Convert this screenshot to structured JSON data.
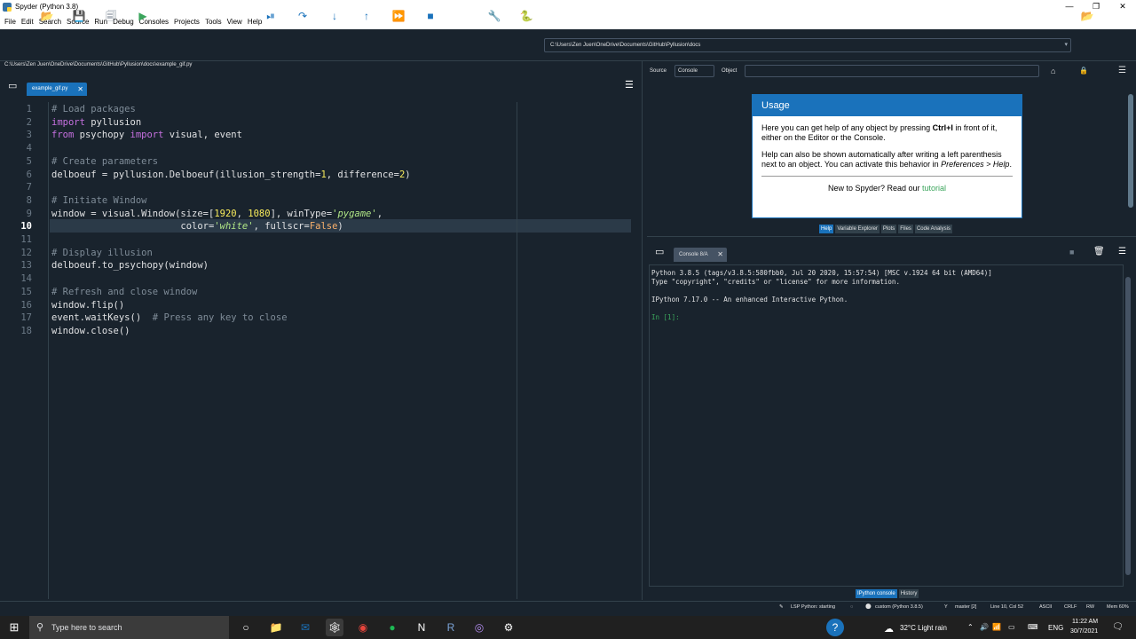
{
  "window": {
    "title": "Spyder (Python 3.8)"
  },
  "menu": [
    "File",
    "Edit",
    "Search",
    "Source",
    "Run",
    "Debug",
    "Consoles",
    "Projects",
    "Tools",
    "View",
    "Help"
  ],
  "toolbar": {
    "path": "C:\\Users\\Zen Juen\\OneDrive\\Documents\\GitHub\\Pyllusion\\docs"
  },
  "editor": {
    "file_path": "C:\\Users\\Zen Juen\\OneDrive\\Documents\\GitHub\\Pyllusion\\docs\\example_gif.py",
    "tab": "example_gif.py",
    "current_line": 10,
    "line_numbers": [
      "1",
      "2",
      "3",
      "4",
      "5",
      "6",
      "7",
      "8",
      "9",
      "10",
      "11",
      "12",
      "13",
      "14",
      "15",
      "16",
      "17",
      "18"
    ],
    "lines": [
      "# Load packages",
      "import pyllusion",
      "from psychopy import visual, event",
      "",
      "# Create parameters",
      "delboeuf = pyllusion.Delboeuf(illusion_strength=1, difference=2)",
      "",
      "# Initiate Window",
      "window = visual.Window(size=[1920, 1080], winType='pygame',",
      "                       color='white', fullscr=False)",
      "",
      "# Display illusion",
      "delboeuf.to_psychopy(window)",
      "",
      "# Refresh and close window",
      "window.flip()",
      "event.waitKeys()  # Press any key to close",
      "window.close()"
    ]
  },
  "help": {
    "source_label": "Source",
    "source_value": "Console",
    "object_label": "Object",
    "usage_title": "Usage",
    "p1a": "Here you can get help of any object by pressing ",
    "p1b": "Ctrl+I",
    "p1c": " in front of it, either on the Editor or the Console.",
    "p2a": "Help can also be shown automatically after writing a left parenthesis next to an object. You can activate this behavior in ",
    "p2b": "Preferences > Help",
    "p2c": ".",
    "tutorial_text": "New to Spyder? Read our ",
    "tutorial_link": "tutorial",
    "tabs": [
      "Help",
      "Variable Explorer",
      "Plots",
      "Files",
      "Code Analysis"
    ]
  },
  "console": {
    "tab": "Console 8/A",
    "line1": "Python 3.8.5 (tags/v3.8.5:580fbb0, Jul 20 2020, 15:57:54) [MSC v.1924 64 bit (AMD64)]",
    "line2": "Type \"copyright\", \"credits\" or \"license\" for more information.",
    "line3": "IPython 7.17.0 -- An enhanced Interactive Python.",
    "prompt": "In [1]:",
    "tabs": [
      "IPython console",
      "History"
    ]
  },
  "status": {
    "lsp": "LSP Python: starting",
    "env": "custom (Python 3.8.5)",
    "git": "master [2]",
    "pos": "Line 10, Col 52",
    "enc": "ASCII",
    "eol": "CRLF",
    "rw": "RW",
    "mem": "Mem 60%"
  },
  "taskbar": {
    "search_placeholder": "Type here to search",
    "weather": "32°C  Light rain",
    "lang": "ENG",
    "time": "11:22 AM",
    "date": "30/7/2021"
  },
  "colors": {
    "accent": "#1a72bb",
    "background": "#19232d",
    "green": "#3ba55c"
  }
}
